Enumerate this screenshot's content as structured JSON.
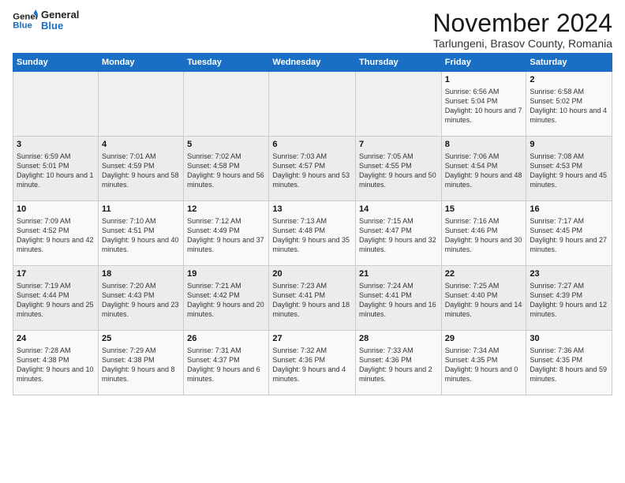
{
  "logo": {
    "line1": "General",
    "line2": "Blue"
  },
  "title": "November 2024",
  "subtitle": "Tarlungeni, Brasov County, Romania",
  "headers": [
    "Sunday",
    "Monday",
    "Tuesday",
    "Wednesday",
    "Thursday",
    "Friday",
    "Saturday"
  ],
  "weeks": [
    [
      {
        "day": "",
        "info": ""
      },
      {
        "day": "",
        "info": ""
      },
      {
        "day": "",
        "info": ""
      },
      {
        "day": "",
        "info": ""
      },
      {
        "day": "",
        "info": ""
      },
      {
        "day": "1",
        "info": "Sunrise: 6:56 AM\nSunset: 5:04 PM\nDaylight: 10 hours and 7 minutes."
      },
      {
        "day": "2",
        "info": "Sunrise: 6:58 AM\nSunset: 5:02 PM\nDaylight: 10 hours and 4 minutes."
      }
    ],
    [
      {
        "day": "3",
        "info": "Sunrise: 6:59 AM\nSunset: 5:01 PM\nDaylight: 10 hours and 1 minute."
      },
      {
        "day": "4",
        "info": "Sunrise: 7:01 AM\nSunset: 4:59 PM\nDaylight: 9 hours and 58 minutes."
      },
      {
        "day": "5",
        "info": "Sunrise: 7:02 AM\nSunset: 4:58 PM\nDaylight: 9 hours and 56 minutes."
      },
      {
        "day": "6",
        "info": "Sunrise: 7:03 AM\nSunset: 4:57 PM\nDaylight: 9 hours and 53 minutes."
      },
      {
        "day": "7",
        "info": "Sunrise: 7:05 AM\nSunset: 4:55 PM\nDaylight: 9 hours and 50 minutes."
      },
      {
        "day": "8",
        "info": "Sunrise: 7:06 AM\nSunset: 4:54 PM\nDaylight: 9 hours and 48 minutes."
      },
      {
        "day": "9",
        "info": "Sunrise: 7:08 AM\nSunset: 4:53 PM\nDaylight: 9 hours and 45 minutes."
      }
    ],
    [
      {
        "day": "10",
        "info": "Sunrise: 7:09 AM\nSunset: 4:52 PM\nDaylight: 9 hours and 42 minutes."
      },
      {
        "day": "11",
        "info": "Sunrise: 7:10 AM\nSunset: 4:51 PM\nDaylight: 9 hours and 40 minutes."
      },
      {
        "day": "12",
        "info": "Sunrise: 7:12 AM\nSunset: 4:49 PM\nDaylight: 9 hours and 37 minutes."
      },
      {
        "day": "13",
        "info": "Sunrise: 7:13 AM\nSunset: 4:48 PM\nDaylight: 9 hours and 35 minutes."
      },
      {
        "day": "14",
        "info": "Sunrise: 7:15 AM\nSunset: 4:47 PM\nDaylight: 9 hours and 32 minutes."
      },
      {
        "day": "15",
        "info": "Sunrise: 7:16 AM\nSunset: 4:46 PM\nDaylight: 9 hours and 30 minutes."
      },
      {
        "day": "16",
        "info": "Sunrise: 7:17 AM\nSunset: 4:45 PM\nDaylight: 9 hours and 27 minutes."
      }
    ],
    [
      {
        "day": "17",
        "info": "Sunrise: 7:19 AM\nSunset: 4:44 PM\nDaylight: 9 hours and 25 minutes."
      },
      {
        "day": "18",
        "info": "Sunrise: 7:20 AM\nSunset: 4:43 PM\nDaylight: 9 hours and 23 minutes."
      },
      {
        "day": "19",
        "info": "Sunrise: 7:21 AM\nSunset: 4:42 PM\nDaylight: 9 hours and 20 minutes."
      },
      {
        "day": "20",
        "info": "Sunrise: 7:23 AM\nSunset: 4:41 PM\nDaylight: 9 hours and 18 minutes."
      },
      {
        "day": "21",
        "info": "Sunrise: 7:24 AM\nSunset: 4:41 PM\nDaylight: 9 hours and 16 minutes."
      },
      {
        "day": "22",
        "info": "Sunrise: 7:25 AM\nSunset: 4:40 PM\nDaylight: 9 hours and 14 minutes."
      },
      {
        "day": "23",
        "info": "Sunrise: 7:27 AM\nSunset: 4:39 PM\nDaylight: 9 hours and 12 minutes."
      }
    ],
    [
      {
        "day": "24",
        "info": "Sunrise: 7:28 AM\nSunset: 4:38 PM\nDaylight: 9 hours and 10 minutes."
      },
      {
        "day": "25",
        "info": "Sunrise: 7:29 AM\nSunset: 4:38 PM\nDaylight: 9 hours and 8 minutes."
      },
      {
        "day": "26",
        "info": "Sunrise: 7:31 AM\nSunset: 4:37 PM\nDaylight: 9 hours and 6 minutes."
      },
      {
        "day": "27",
        "info": "Sunrise: 7:32 AM\nSunset: 4:36 PM\nDaylight: 9 hours and 4 minutes."
      },
      {
        "day": "28",
        "info": "Sunrise: 7:33 AM\nSunset: 4:36 PM\nDaylight: 9 hours and 2 minutes."
      },
      {
        "day": "29",
        "info": "Sunrise: 7:34 AM\nSunset: 4:35 PM\nDaylight: 9 hours and 0 minutes."
      },
      {
        "day": "30",
        "info": "Sunrise: 7:36 AM\nSunset: 4:35 PM\nDaylight: 8 hours and 59 minutes."
      }
    ]
  ]
}
